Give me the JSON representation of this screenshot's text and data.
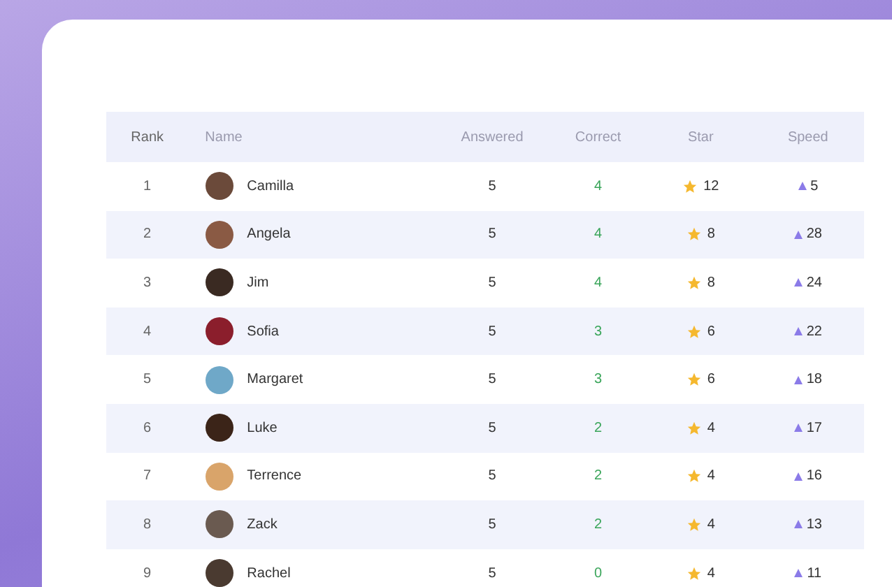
{
  "table": {
    "columns": [
      "Rank",
      "Name",
      "Answered",
      "Correct",
      "Star",
      "Speed"
    ],
    "rows": [
      {
        "rank": "1",
        "name": "Camilla",
        "answered": "5",
        "correct": "4",
        "star": "12",
        "speed": "5",
        "color": "#6b4a3a"
      },
      {
        "rank": "2",
        "name": "Angela",
        "answered": "5",
        "correct": "4",
        "star": "8",
        "speed": "28",
        "color": "#8a5a44"
      },
      {
        "rank": "3",
        "name": "Jim",
        "answered": "5",
        "correct": "4",
        "star": "8",
        "speed": "24",
        "color": "#3a2a22"
      },
      {
        "rank": "4",
        "name": "Sofia",
        "answered": "5",
        "correct": "3",
        "star": "6",
        "speed": "22",
        "color": "#8b1e2c"
      },
      {
        "rank": "5",
        "name": "Margaret",
        "answered": "5",
        "correct": "3",
        "star": "6",
        "speed": "18",
        "color": "#6fa8c8"
      },
      {
        "rank": "6",
        "name": "Luke",
        "answered": "5",
        "correct": "2",
        "star": "4",
        "speed": "17",
        "color": "#3b2418"
      },
      {
        "rank": "7",
        "name": "Terrence",
        "answered": "5",
        "correct": "2",
        "star": "4",
        "speed": "16",
        "color": "#d9a46a"
      },
      {
        "rank": "8",
        "name": "Zack",
        "answered": "5",
        "correct": "2",
        "star": "4",
        "speed": "13",
        "color": "#6a5a50"
      },
      {
        "rank": "9",
        "name": "Rachel",
        "answered": "5",
        "correct": "0",
        "star": "4",
        "speed": "11",
        "color": "#4a3a30"
      }
    ]
  }
}
